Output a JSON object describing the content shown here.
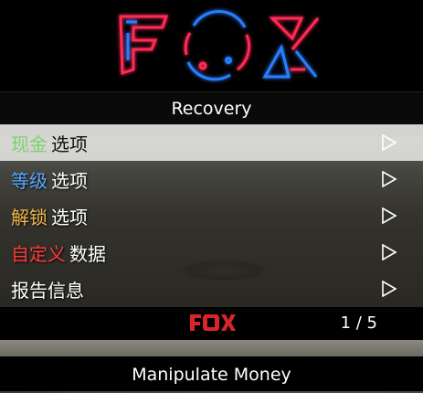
{
  "header": {
    "logo_text": "FOX",
    "subtitle": "Recovery"
  },
  "menu": {
    "items": [
      {
        "accent": "现金",
        "rest": "选项",
        "accent_color": "#79d36c",
        "selected": true,
        "icon": "triangle-right-icon"
      },
      {
        "accent": "等级",
        "rest": "选项",
        "accent_color": "#5aa8ff",
        "selected": false,
        "icon": "triangle-right-icon"
      },
      {
        "accent": "解锁",
        "rest": "选项",
        "accent_color": "#f0b74a",
        "selected": false,
        "icon": "triangle-right-icon"
      },
      {
        "accent": "自定义",
        "rest": "数据",
        "accent_color": "#ff3b3b",
        "selected": false,
        "icon": "triangle-right-icon"
      },
      {
        "accent": "",
        "rest": "报告信息",
        "accent_color": "#ffffff",
        "selected": false,
        "icon": "triangle-right-icon"
      }
    ]
  },
  "footer": {
    "logo_text": "FOX",
    "page_counter": "1 / 5"
  },
  "description": "Manipulate Money",
  "colors": {
    "neon_red": "#ff2a55",
    "neon_blue": "#2a7dff",
    "footer_logo": "#d7262a"
  }
}
